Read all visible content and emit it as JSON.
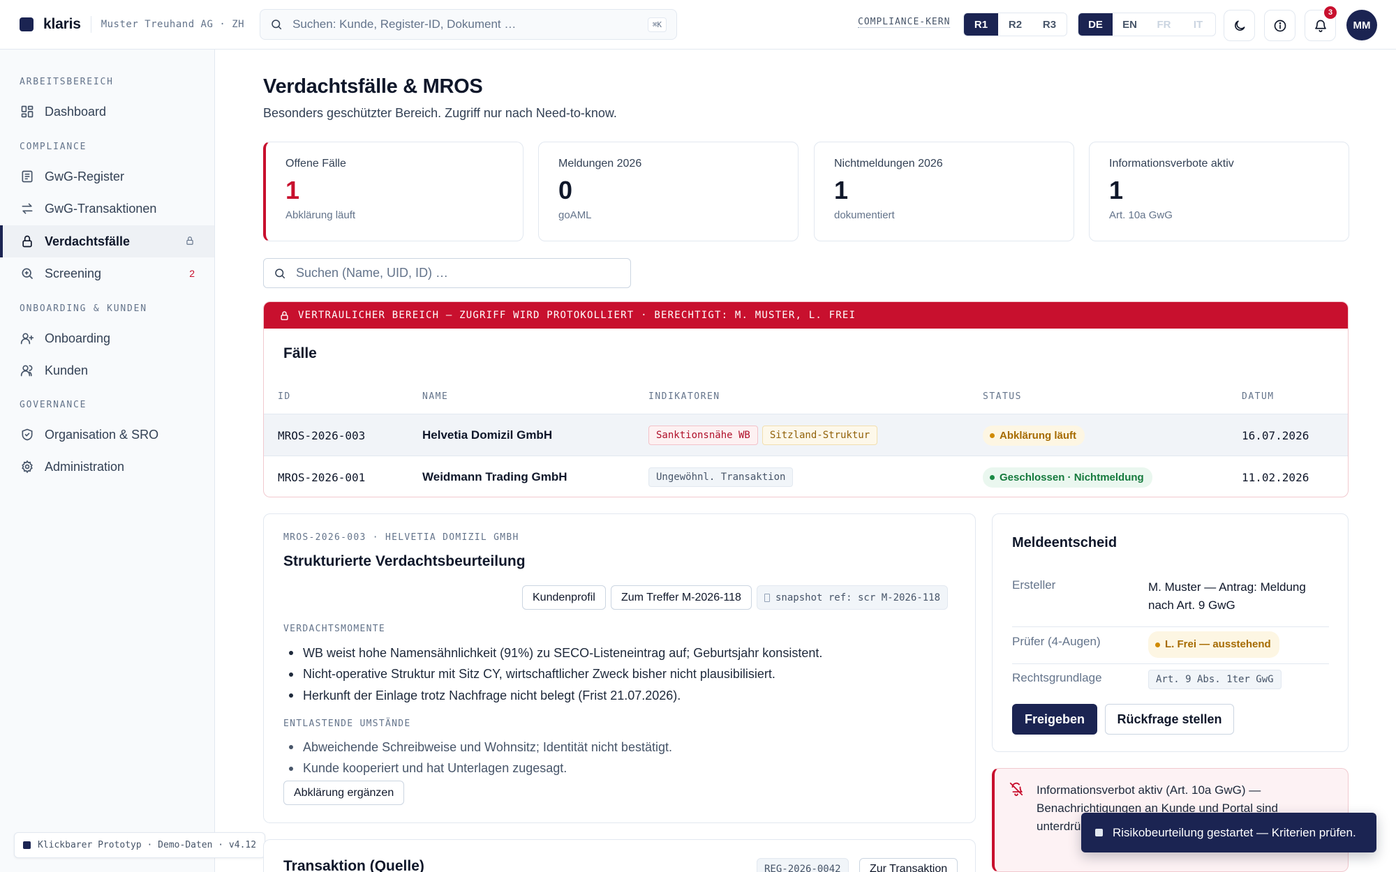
{
  "header": {
    "brand": "klaris",
    "tenant": "Muster Treuhand AG · ZH",
    "search_placeholder": "Suchen: Kunde, Register-ID, Dokument …",
    "search_shortcut": "⌘K",
    "compliance_label": "COMPLIANCE-KERN",
    "roles": [
      "R1",
      "R2",
      "R3"
    ],
    "active_role": "R1",
    "languages": [
      "DE",
      "EN",
      "FR",
      "IT"
    ],
    "active_language": "DE",
    "notification_count": "3",
    "avatar_initials": "MM"
  },
  "sidebar": {
    "sections": [
      {
        "label": "ARBEITSBEREICH"
      },
      {
        "label": "COMPLIANCE"
      },
      {
        "label": "ONBOARDING & KUNDEN"
      },
      {
        "label": "GOVERNANCE"
      }
    ],
    "items": [
      {
        "label": "Dashboard",
        "icon": "dashboard-icon"
      },
      {
        "label": "GwG-Register",
        "icon": "register-icon"
      },
      {
        "label": "GwG-Transaktionen",
        "icon": "transfer-icon"
      },
      {
        "label": "Verdachtsfälle",
        "icon": "lock-icon",
        "active": true
      },
      {
        "label": "Screening",
        "icon": "screening-icon",
        "badge": "2"
      },
      {
        "label": "Onboarding",
        "icon": "user-plus-icon"
      },
      {
        "label": "Kunden",
        "icon": "users-icon"
      },
      {
        "label": "Organisation & SRO",
        "icon": "shield-icon"
      },
      {
        "label": "Administration",
        "icon": "gear-icon"
      }
    ],
    "prototype_note": "Klickbarer Prototyp · Demo-Daten · v4.12"
  },
  "page": {
    "title": "Verdachtsfälle & MROS",
    "subtitle": "Besonders geschützter Bereich. Zugriff nur nach Need-to-know."
  },
  "kpis": [
    {
      "label": "Offene Fälle",
      "value": "1",
      "hint": "Abklärung läuft"
    },
    {
      "label": "Meldungen 2026",
      "value": "0",
      "hint": "goAML"
    },
    {
      "label": "Nichtmeldungen 2026",
      "value": "1",
      "hint": "dokumentiert"
    },
    {
      "label": "Informationsverbote aktiv",
      "value": "1",
      "hint": "Art. 10a GwG"
    }
  ],
  "case_search_placeholder": "Suchen (Name, UID, ID) …",
  "confidential_banner": "VERTRAULICHER BEREICH — ZUGRIFF WIRD PROTOKOLLIERT · BERECHTIGT: M. MUSTER, L. FREI",
  "cases": {
    "title": "Fälle",
    "columns": [
      "ID",
      "NAME",
      "INDIKATOREN",
      "STATUS",
      "DATUM"
    ],
    "rows": [
      {
        "id": "MROS-2026-003",
        "name": "Helvetia Domizil GmbH",
        "indicators": [
          "Sanktionsnähe WB",
          "Sitzland-Struktur"
        ],
        "status": "Abklärung läuft",
        "date": "16.07.2026"
      },
      {
        "id": "MROS-2026-001",
        "name": "Weidmann Trading GmbH",
        "indicators": [
          "Ungewöhnl. Transaktion"
        ],
        "status": "Geschlossen · Nichtmeldung",
        "date": "11.02.2026"
      }
    ]
  },
  "detail": {
    "eyebrow": "MROS-2026-003 · HELVETIA DOMIZIL GMBH",
    "title": "Strukturierte Verdachtsbeurteilung",
    "btn_profile": "Kundenprofil",
    "btn_hit": "Zum Treffer M-2026-118",
    "snapshot": "snapshot ref: scr M-2026-118",
    "suspicion_label": "VERDACHTSMOMENTE",
    "suspicion_items": [
      "WB weist hohe Namensähnlichkeit (91%) zu SECO-Listeneintrag auf; Geburtsjahr konsistent.",
      "Nicht-operative Struktur mit Sitz CY, wirtschaftlicher Zweck bisher nicht plausibilisiert.",
      "Herkunft der Einlage trotz Nachfrage nicht belegt (Frist 21.07.2026)."
    ],
    "exculpatory_label": "ENTLASTENDE UMSTÄNDE",
    "exculpatory_items": [
      "Abweichende Schreibweise und Wohnsitz; Identität nicht bestätigt.",
      "Kunde kooperiert und hat Unterlagen zugesagt."
    ],
    "btn_extend": "Abklärung ergänzen"
  },
  "decision": {
    "title": "Meldeentscheid",
    "creator_label": "Ersteller",
    "creator_value": "M. Muster — Antrag: Meldung nach Art. 9 GwG",
    "reviewer_label": "Prüfer (4-Augen)",
    "reviewer_value": "L. Frei — ausstehend",
    "legal_label": "Rechtsgrundlage",
    "legal_value": "Art. 9 Abs. 1ter GwG",
    "btn_approve": "Freigeben",
    "btn_query": "Rückfrage stellen"
  },
  "info_ban": "Informationsverbot aktiv (Art. 10a GwG) — Benachrichtigungen an Kunde und Portal sind unterdrückt.",
  "transaction": {
    "title": "Transaktion (Quelle)",
    "ref": "REG-2026-0042",
    "btn": "Zur Transaktion"
  },
  "toast": "Risikobeurteilung gestartet — Kriterien prüfen.",
  "colors": {
    "brand": "#1b2452",
    "alert": "#c8102e"
  }
}
